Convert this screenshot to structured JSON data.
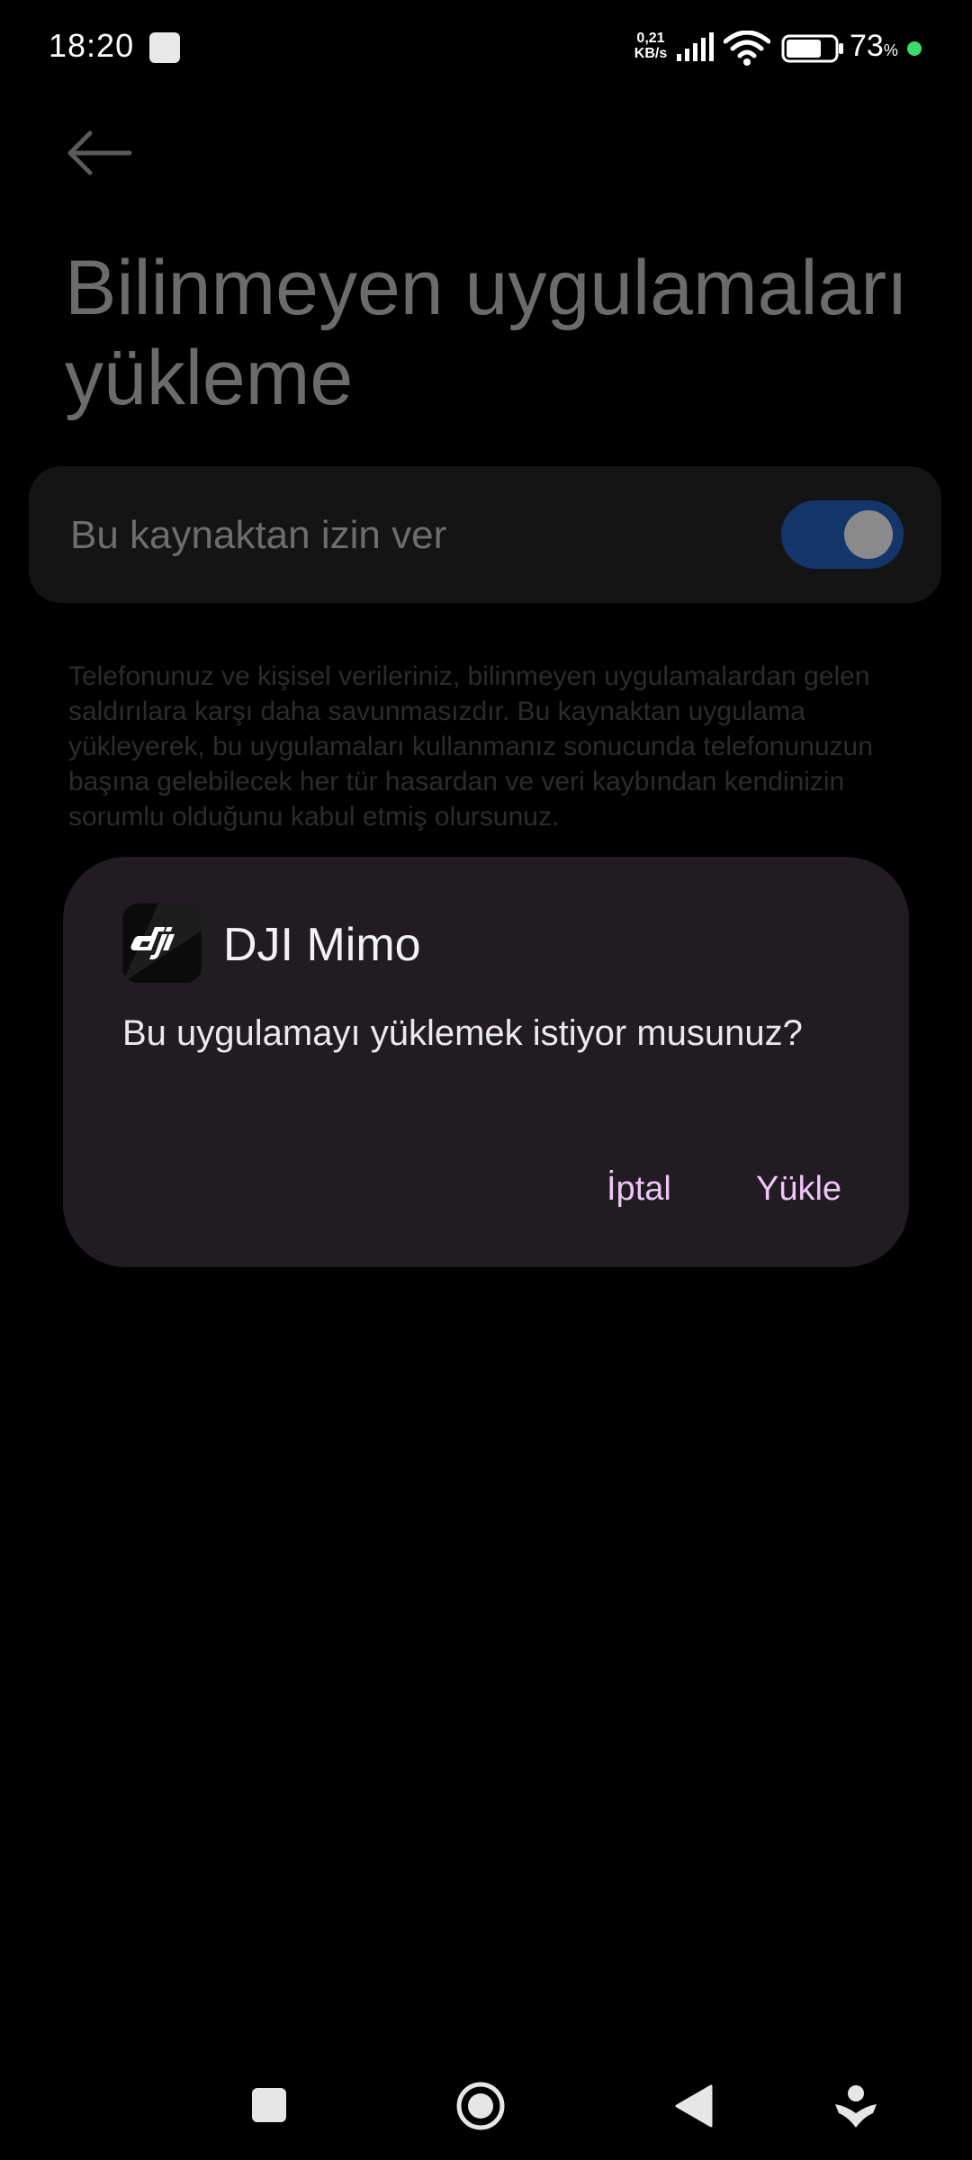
{
  "status_bar": {
    "time": "18:20",
    "net_speed_value": "0,21",
    "net_speed_unit": "KB/s",
    "battery_percent": "73",
    "battery_percent_sign": "%",
    "battery_level": 0.73,
    "icons": [
      "notification-icon",
      "signal-icon",
      "wifi-icon",
      "battery-icon"
    ]
  },
  "page": {
    "title": "Bilinmeyen uygulamaları yükleme",
    "setting": {
      "label": "Bu kaynaktan izin ver",
      "toggle_on": true
    },
    "warning": "Telefonunuz ve kişisel verileriniz, bilinmeyen uygulamalardan gelen saldırılara karşı daha savunmasızdır. Bu kaynaktan uygulama yükleyerek, bu uygulamaları kullanmanız sonucunda telefonunuzun başına gelebilecek her tür hasardan ve veri kaybından kendinizin sorumlu olduğunu kabul etmiş olursunuz."
  },
  "dialog": {
    "app_name": "DJI Mimo",
    "message": "Bu uygulamayı yüklemek istiyor musunuz?",
    "cancel_label": "İptal",
    "install_label": "Yükle"
  },
  "nav_bar": {
    "icons": [
      "recents-icon",
      "home-icon",
      "back-icon",
      "assistant-icon"
    ]
  },
  "colors": {
    "background": "#000000",
    "dialog_bg": "#201c22",
    "dialog_button": "#eec6f4",
    "toggle_track": "#14356a",
    "charge_dot": "#3ddc6a"
  }
}
